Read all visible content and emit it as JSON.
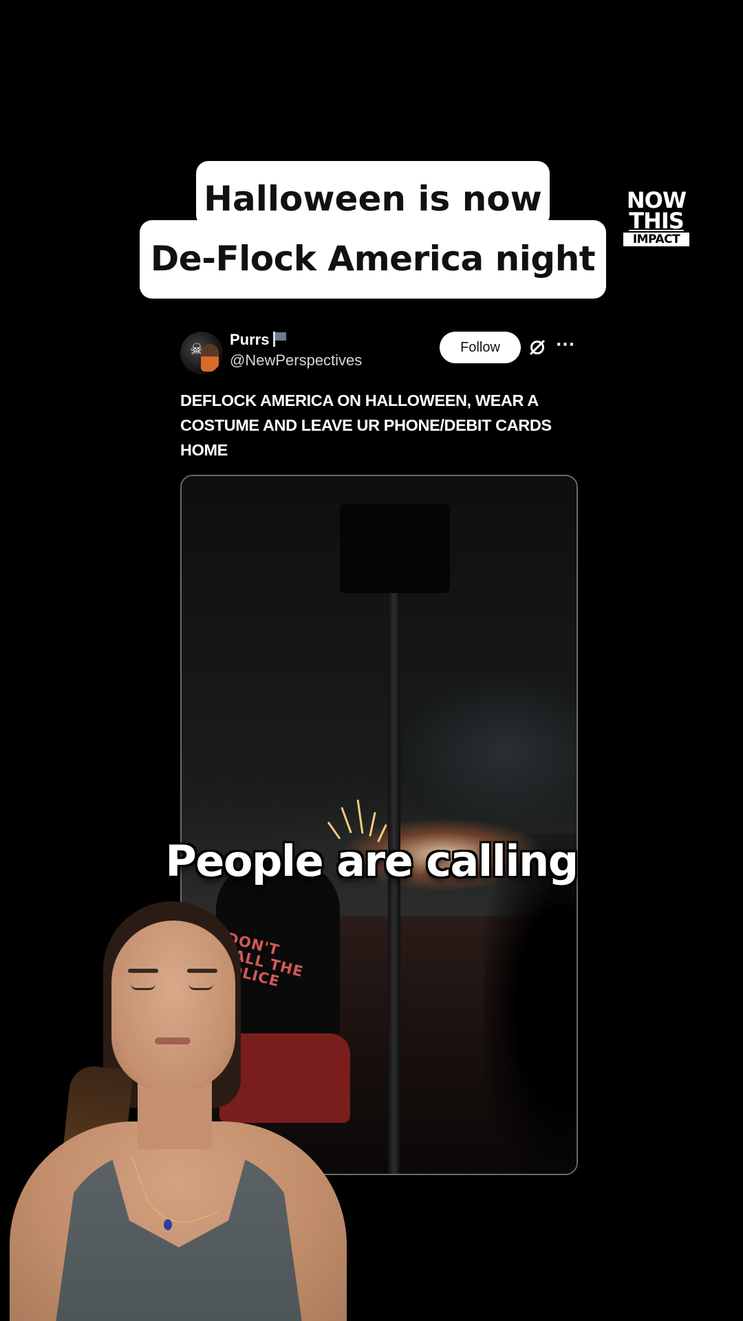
{
  "headline": {
    "line1": "Halloween is now",
    "line2": "De-Flock America night"
  },
  "logo": {
    "line1": "NOW",
    "line2": "THIS",
    "line3": "IMPACT"
  },
  "tweet": {
    "display_name": "Purrs",
    "handle": "@NewPerspectives",
    "follow_label": "Follow",
    "more_label": "···",
    "text": "DEFLOCK AMERICA ON HALLOWEEN, WEAR A COSTUME AND LEAVE UR PHONE/DEBIT CARDS HOME",
    "media": {
      "shirt_text": "DON'T CALL THE POLICE"
    }
  },
  "subtitle": "People are calling",
  "colors": {
    "background": "#000000",
    "caption_bg": "#ffffff",
    "caption_text": "#111111",
    "follow_bg": "#ffffff"
  }
}
